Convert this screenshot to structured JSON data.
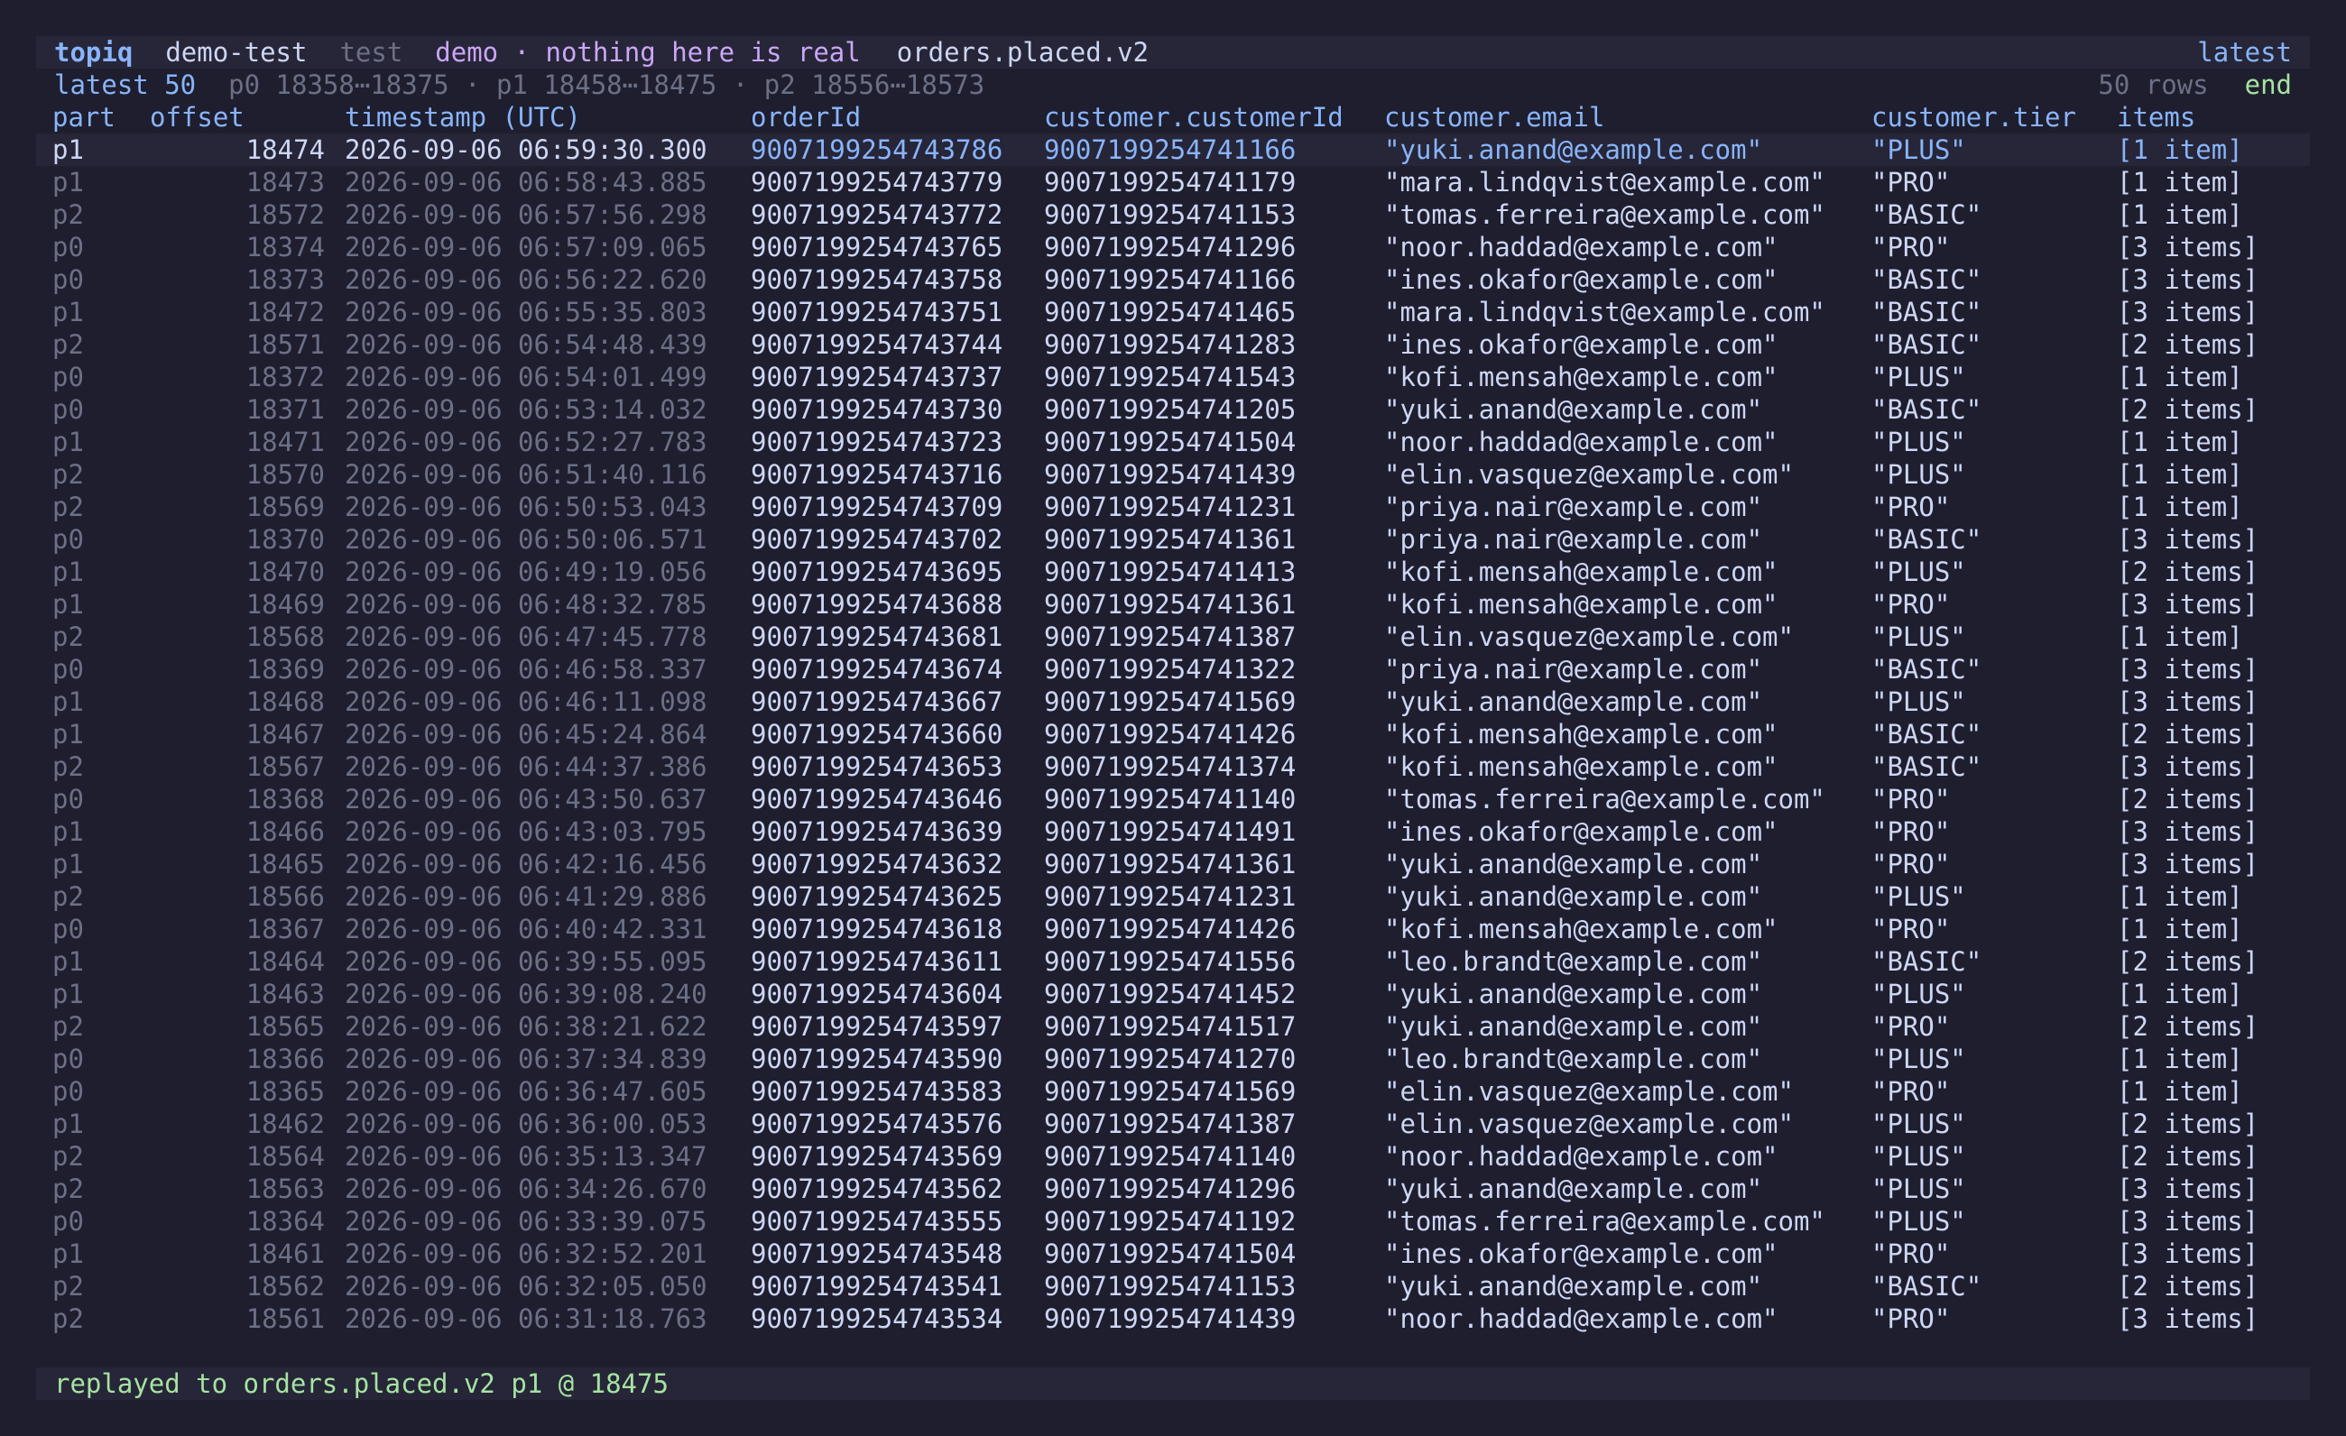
{
  "topbar": {
    "app": "topiq",
    "context": "demo-test",
    "env": "test",
    "banner": "demo · nothing here is real",
    "topic": "orders.placed.v2",
    "mode": "latest"
  },
  "subbar": {
    "view": "latest 50",
    "ranges": "p0 18358⋯18375 · p1 18458⋯18475 · p2 18556⋯18573",
    "rows": "50 rows",
    "position": "end"
  },
  "columns": [
    "part",
    "offset",
    "timestamp (UTC)",
    "orderId",
    "customer.customerId",
    "customer.email",
    "customer.tier",
    "items"
  ],
  "rows": [
    [
      "p1",
      "18474",
      "2026-09-06 06:59:30.300",
      "9007199254743786",
      "9007199254741166",
      "\"yuki.anand@example.com\"",
      "\"PLUS\"",
      "[1 item]"
    ],
    [
      "p1",
      "18473",
      "2026-09-06 06:58:43.885",
      "9007199254743779",
      "9007199254741179",
      "\"mara.lindqvist@example.com\"",
      "\"PRO\"",
      "[1 item]"
    ],
    [
      "p2",
      "18572",
      "2026-09-06 06:57:56.298",
      "9007199254743772",
      "9007199254741153",
      "\"tomas.ferreira@example.com\"",
      "\"BASIC\"",
      "[1 item]"
    ],
    [
      "p0",
      "18374",
      "2026-09-06 06:57:09.065",
      "9007199254743765",
      "9007199254741296",
      "\"noor.haddad@example.com\"",
      "\"PRO\"",
      "[3 items]"
    ],
    [
      "p0",
      "18373",
      "2026-09-06 06:56:22.620",
      "9007199254743758",
      "9007199254741166",
      "\"ines.okafor@example.com\"",
      "\"BASIC\"",
      "[3 items]"
    ],
    [
      "p1",
      "18472",
      "2026-09-06 06:55:35.803",
      "9007199254743751",
      "9007199254741465",
      "\"mara.lindqvist@example.com\"",
      "\"BASIC\"",
      "[3 items]"
    ],
    [
      "p2",
      "18571",
      "2026-09-06 06:54:48.439",
      "9007199254743744",
      "9007199254741283",
      "\"ines.okafor@example.com\"",
      "\"BASIC\"",
      "[2 items]"
    ],
    [
      "p0",
      "18372",
      "2026-09-06 06:54:01.499",
      "9007199254743737",
      "9007199254741543",
      "\"kofi.mensah@example.com\"",
      "\"PLUS\"",
      "[1 item]"
    ],
    [
      "p0",
      "18371",
      "2026-09-06 06:53:14.032",
      "9007199254743730",
      "9007199254741205",
      "\"yuki.anand@example.com\"",
      "\"BASIC\"",
      "[2 items]"
    ],
    [
      "p1",
      "18471",
      "2026-09-06 06:52:27.783",
      "9007199254743723",
      "9007199254741504",
      "\"noor.haddad@example.com\"",
      "\"PLUS\"",
      "[1 item]"
    ],
    [
      "p2",
      "18570",
      "2026-09-06 06:51:40.116",
      "9007199254743716",
      "9007199254741439",
      "\"elin.vasquez@example.com\"",
      "\"PLUS\"",
      "[1 item]"
    ],
    [
      "p2",
      "18569",
      "2026-09-06 06:50:53.043",
      "9007199254743709",
      "9007199254741231",
      "\"priya.nair@example.com\"",
      "\"PRO\"",
      "[1 item]"
    ],
    [
      "p0",
      "18370",
      "2026-09-06 06:50:06.571",
      "9007199254743702",
      "9007199254741361",
      "\"priya.nair@example.com\"",
      "\"BASIC\"",
      "[3 items]"
    ],
    [
      "p1",
      "18470",
      "2026-09-06 06:49:19.056",
      "9007199254743695",
      "9007199254741413",
      "\"kofi.mensah@example.com\"",
      "\"PLUS\"",
      "[2 items]"
    ],
    [
      "p1",
      "18469",
      "2026-09-06 06:48:32.785",
      "9007199254743688",
      "9007199254741361",
      "\"kofi.mensah@example.com\"",
      "\"PRO\"",
      "[3 items]"
    ],
    [
      "p2",
      "18568",
      "2026-09-06 06:47:45.778",
      "9007199254743681",
      "9007199254741387",
      "\"elin.vasquez@example.com\"",
      "\"PLUS\"",
      "[1 item]"
    ],
    [
      "p0",
      "18369",
      "2026-09-06 06:46:58.337",
      "9007199254743674",
      "9007199254741322",
      "\"priya.nair@example.com\"",
      "\"BASIC\"",
      "[3 items]"
    ],
    [
      "p1",
      "18468",
      "2026-09-06 06:46:11.098",
      "9007199254743667",
      "9007199254741569",
      "\"yuki.anand@example.com\"",
      "\"PLUS\"",
      "[3 items]"
    ],
    [
      "p1",
      "18467",
      "2026-09-06 06:45:24.864",
      "9007199254743660",
      "9007199254741426",
      "\"kofi.mensah@example.com\"",
      "\"BASIC\"",
      "[2 items]"
    ],
    [
      "p2",
      "18567",
      "2026-09-06 06:44:37.386",
      "9007199254743653",
      "9007199254741374",
      "\"kofi.mensah@example.com\"",
      "\"BASIC\"",
      "[3 items]"
    ],
    [
      "p0",
      "18368",
      "2026-09-06 06:43:50.637",
      "9007199254743646",
      "9007199254741140",
      "\"tomas.ferreira@example.com\"",
      "\"PRO\"",
      "[2 items]"
    ],
    [
      "p1",
      "18466",
      "2026-09-06 06:43:03.795",
      "9007199254743639",
      "9007199254741491",
      "\"ines.okafor@example.com\"",
      "\"PRO\"",
      "[3 items]"
    ],
    [
      "p1",
      "18465",
      "2026-09-06 06:42:16.456",
      "9007199254743632",
      "9007199254741361",
      "\"yuki.anand@example.com\"",
      "\"PRO\"",
      "[3 items]"
    ],
    [
      "p2",
      "18566",
      "2026-09-06 06:41:29.886",
      "9007199254743625",
      "9007199254741231",
      "\"yuki.anand@example.com\"",
      "\"PLUS\"",
      "[1 item]"
    ],
    [
      "p0",
      "18367",
      "2026-09-06 06:40:42.331",
      "9007199254743618",
      "9007199254741426",
      "\"kofi.mensah@example.com\"",
      "\"PRO\"",
      "[1 item]"
    ],
    [
      "p1",
      "18464",
      "2026-09-06 06:39:55.095",
      "9007199254743611",
      "9007199254741556",
      "\"leo.brandt@example.com\"",
      "\"BASIC\"",
      "[2 items]"
    ],
    [
      "p1",
      "18463",
      "2026-09-06 06:39:08.240",
      "9007199254743604",
      "9007199254741452",
      "\"yuki.anand@example.com\"",
      "\"PLUS\"",
      "[1 item]"
    ],
    [
      "p2",
      "18565",
      "2026-09-06 06:38:21.622",
      "9007199254743597",
      "9007199254741517",
      "\"yuki.anand@example.com\"",
      "\"PRO\"",
      "[2 items]"
    ],
    [
      "p0",
      "18366",
      "2026-09-06 06:37:34.839",
      "9007199254743590",
      "9007199254741270",
      "\"leo.brandt@example.com\"",
      "\"PLUS\"",
      "[1 item]"
    ],
    [
      "p0",
      "18365",
      "2026-09-06 06:36:47.605",
      "9007199254743583",
      "9007199254741569",
      "\"elin.vasquez@example.com\"",
      "\"PRO\"",
      "[1 item]"
    ],
    [
      "p1",
      "18462",
      "2026-09-06 06:36:00.053",
      "9007199254743576",
      "9007199254741387",
      "\"elin.vasquez@example.com\"",
      "\"PLUS\"",
      "[2 items]"
    ],
    [
      "p2",
      "18564",
      "2026-09-06 06:35:13.347",
      "9007199254743569",
      "9007199254741140",
      "\"noor.haddad@example.com\"",
      "\"PLUS\"",
      "[2 items]"
    ],
    [
      "p2",
      "18563",
      "2026-09-06 06:34:26.670",
      "9007199254743562",
      "9007199254741296",
      "\"yuki.anand@example.com\"",
      "\"PLUS\"",
      "[3 items]"
    ],
    [
      "p0",
      "18364",
      "2026-09-06 06:33:39.075",
      "9007199254743555",
      "9007199254741192",
      "\"tomas.ferreira@example.com\"",
      "\"PLUS\"",
      "[3 items]"
    ],
    [
      "p1",
      "18461",
      "2026-09-06 06:32:52.201",
      "9007199254743548",
      "9007199254741504",
      "\"ines.okafor@example.com\"",
      "\"PRO\"",
      "[3 items]"
    ],
    [
      "p2",
      "18562",
      "2026-09-06 06:32:05.050",
      "9007199254743541",
      "9007199254741153",
      "\"yuki.anand@example.com\"",
      "\"BASIC\"",
      "[2 items]"
    ],
    [
      "p2",
      "18561",
      "2026-09-06 06:31:18.763",
      "9007199254743534",
      "9007199254741439",
      "\"noor.haddad@example.com\"",
      "\"PRO\"",
      "[3 items]"
    ]
  ],
  "status": "replayed to orders.placed.v2 p1 @ 18475",
  "colors": {
    "background": "#1e1e2e",
    "accent": "#89b4fa",
    "muted": "#6c7086",
    "text": "#cdd6f4",
    "demo": "#cba6f7",
    "ok": "#a6e3a1"
  }
}
